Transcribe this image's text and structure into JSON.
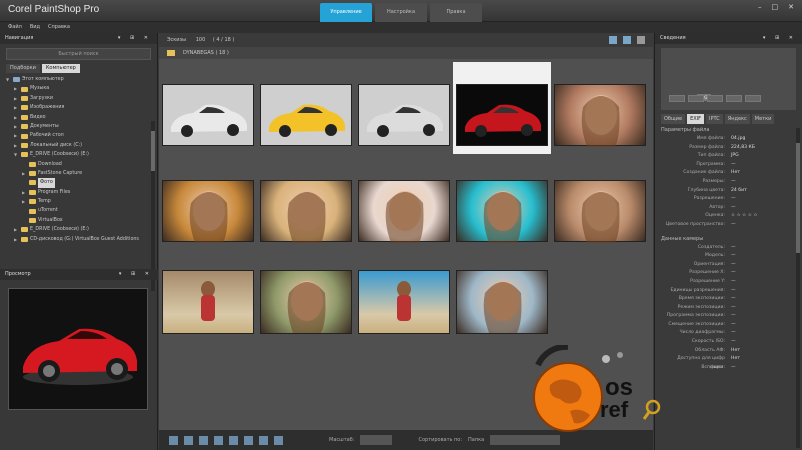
{
  "window": {
    "title": "Corel PaintShop Pro",
    "tabs": [
      "Управление",
      "Настройка",
      "Правка"
    ],
    "active_tab": 0,
    "controls": [
      "–",
      "□",
      "✕"
    ]
  },
  "menu": [
    "Файл",
    "Вид",
    "Справка"
  ],
  "navigation": {
    "header": "Навигация",
    "search_placeholder": "Быстрый поиск",
    "subtabs": [
      "Подборки",
      "Компьютер"
    ],
    "tree": [
      {
        "label": "Этот компьютер",
        "depth": 0,
        "arrow": "▼"
      },
      {
        "label": "Музыка",
        "depth": 1,
        "arrow": "▶"
      },
      {
        "label": "Загрузки",
        "depth": 1,
        "arrow": "▶"
      },
      {
        "label": "Изображения",
        "depth": 1,
        "arrow": "▶"
      },
      {
        "label": "Видео",
        "depth": 1,
        "arrow": "▶"
      },
      {
        "label": "Документы",
        "depth": 1,
        "arrow": "▶"
      },
      {
        "label": "Рабочий стол",
        "depth": 1,
        "arrow": "▶"
      },
      {
        "label": "Локальный диск (C:)",
        "depth": 1,
        "arrow": "▶"
      },
      {
        "label": "E_DRIVE (Сoobsеси) (E:)",
        "depth": 1,
        "arrow": "▼"
      },
      {
        "label": "Download",
        "depth": 2,
        "arrow": ""
      },
      {
        "label": "FastStone Capture",
        "depth": 2,
        "arrow": "▶"
      },
      {
        "label": "Фото",
        "depth": 2,
        "arrow": "",
        "selected": true
      },
      {
        "label": "Program Files",
        "depth": 2,
        "arrow": "▶"
      },
      {
        "label": "Temp",
        "depth": 2,
        "arrow": "▶"
      },
      {
        "label": "uTorrent",
        "depth": 2,
        "arrow": ""
      },
      {
        "label": "VirtualBox",
        "depth": 2,
        "arrow": ""
      },
      {
        "label": "E_DRIVE (Сoobsеси) (E:)",
        "depth": 1,
        "arrow": "▶"
      },
      {
        "label": "CD-дисковод (G:) VirtualBox Guest Additions",
        "depth": 1,
        "arrow": "▶"
      }
    ]
  },
  "preview": {
    "header": "Просмотр"
  },
  "browser": {
    "toolbar_label": "Эскизы",
    "toolbar_count": "100",
    "toolbar_range": "( 4 / 18 )",
    "path_label": "DYNABEGAS ( 18 )",
    "thumbnails": [
      {
        "color": "#e9e9e9",
        "kind": "car-white"
      },
      {
        "color": "#f2c228",
        "kind": "car-yellow"
      },
      {
        "color": "#dcdcdc",
        "kind": "car-white2"
      },
      {
        "color": "#c4161c",
        "kind": "car-red",
        "selected": true
      },
      {
        "color": "#b07a60",
        "kind": "portrait"
      },
      {
        "color": "#c7883a",
        "kind": "portrait"
      },
      {
        "color": "#d9b27a",
        "kind": "portrait"
      },
      {
        "color": "#e8d8cf",
        "kind": "portrait"
      },
      {
        "color": "#27bfd0",
        "kind": "portrait"
      },
      {
        "color": "#b88a6a",
        "kind": "portrait"
      },
      {
        "color": "#a58a6a",
        "kind": "beach"
      },
      {
        "color": "#8f9a6a",
        "kind": "portrait"
      },
      {
        "color": "#3a9ad0",
        "kind": "beach"
      },
      {
        "color": "#9fb8c8",
        "kind": "portrait"
      }
    ],
    "bottom": {
      "scale_label": "Масштаб:",
      "sort_label": "Сортировать по:",
      "sort_value": "Папка"
    }
  },
  "info": {
    "header": "Сведения",
    "format_badge": "JPG",
    "tabs": [
      "Общие",
      "EXIF",
      "IPTC",
      "Яндекс",
      "Метки"
    ],
    "active_tab": 1,
    "file_section": "Параметры файла",
    "file_props": [
      {
        "k": "Имя файла:",
        "v": "04.jpg"
      },
      {
        "k": "Размер файла:",
        "v": "224,83 КБ"
      },
      {
        "k": "Тип файла:",
        "v": "JPG"
      },
      {
        "k": "Программа:",
        "v": "—"
      },
      {
        "k": "Создание файла:",
        "v": "Нет"
      },
      {
        "k": "Размеры:",
        "v": "—"
      },
      {
        "k": "Глубина цвета:",
        "v": "24 бит"
      },
      {
        "k": "Разрешение:",
        "v": "—"
      },
      {
        "k": "Автор:",
        "v": "—"
      },
      {
        "k": "Оценка:",
        "v": "☆ ☆ ☆ ☆ ☆"
      },
      {
        "k": "Цветовое пространство:",
        "v": "—"
      }
    ],
    "camera_section": "Данные камеры",
    "camera_props": [
      {
        "k": "Создатель:",
        "v": "—"
      },
      {
        "k": "Модель:",
        "v": "—"
      },
      {
        "k": "Ориентация:",
        "v": "—"
      },
      {
        "k": "Разрешение X:",
        "v": "—"
      },
      {
        "k": "Разрешение Y:",
        "v": "—"
      },
      {
        "k": "Единицы разрешения:",
        "v": "—"
      },
      {
        "k": "Время экспозиции:",
        "v": "—"
      },
      {
        "k": "Режим экспозиции:",
        "v": "—"
      },
      {
        "k": "Программа экспозиции:",
        "v": "—"
      },
      {
        "k": "Смещение экспозиции:",
        "v": "—"
      },
      {
        "k": "Число диафрагмы:",
        "v": "—"
      },
      {
        "k": "Скорость ISO:",
        "v": "—"
      },
      {
        "k": "Область АФ:",
        "v": "Нет"
      },
      {
        "k": "Доступно для цифр фирм:",
        "v": "Нет"
      },
      {
        "k": "Вспышка:",
        "v": "—"
      }
    ]
  },
  "watermark": {
    "line1": "os",
    "line2": "ref"
  }
}
